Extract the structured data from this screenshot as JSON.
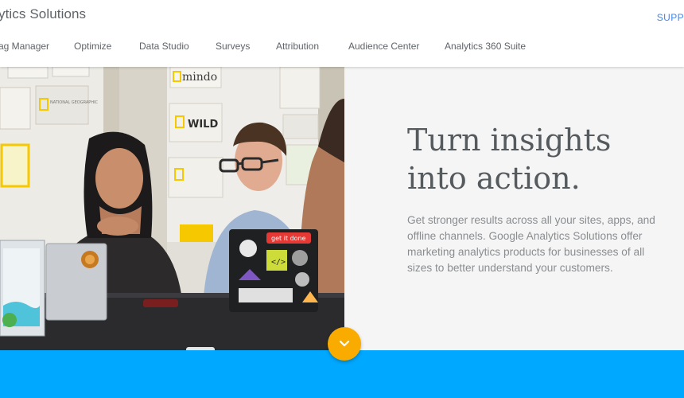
{
  "header": {
    "brand": "ytics Solutions",
    "support": "SUPP"
  },
  "nav": {
    "items": [
      {
        "label": "ag Manager",
        "name": "nav-tag-manager"
      },
      {
        "label": "Optimize",
        "name": "nav-optimize"
      },
      {
        "label": "Data Studio",
        "name": "nav-data-studio"
      },
      {
        "label": "Surveys",
        "name": "nav-surveys"
      },
      {
        "label": "Attribution",
        "name": "nav-attribution"
      },
      {
        "label": "Audience Center",
        "name": "nav-audience-center"
      },
      {
        "label": "Analytics 360 Suite",
        "name": "nav-analytics-360-suite"
      }
    ]
  },
  "hero": {
    "headline_line1": "Turn insights",
    "headline_line2": "into action.",
    "body": "Get stronger results across all your sites, apps, and offline channels. Google Analytics Solutions offer marketing analytics products for businesses of all sizes to better understand your customers.",
    "photo": {
      "poster_mindo": "mindo",
      "poster_wild": "WILD",
      "poster_natgeo": "NATIONAL GEOGRAPHIC",
      "poster_natgeo_channel": "NATIONAL GEOGRAPHIC CHANNEL",
      "poster_natgeo_small": "NAT GEO",
      "sticker_get_it_done": "get it done",
      "sticker_code": "</>"
    }
  },
  "scroll_button": {
    "icon": "chevron-down-icon"
  },
  "colors": {
    "accent_blue": "#00a8ff",
    "scroll_button": "#f9ab00",
    "link_blue": "#4285f4",
    "hero_bg": "#f5f5f5"
  }
}
